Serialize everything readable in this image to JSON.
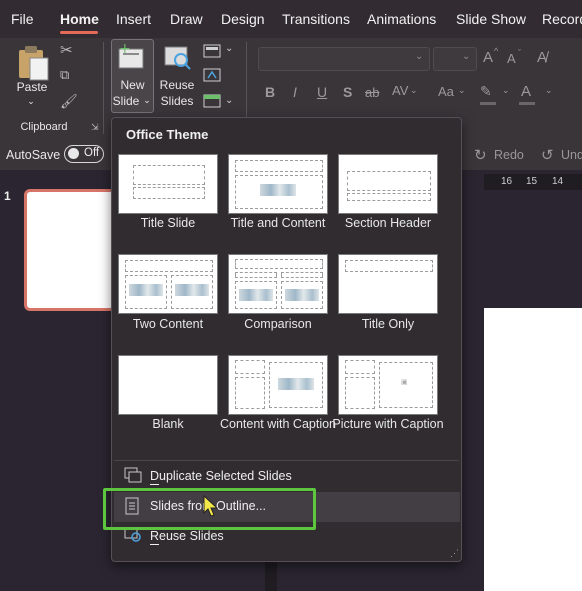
{
  "menubar": {
    "tabs": [
      "File",
      "Home",
      "Insert",
      "Draw",
      "Design",
      "Transitions",
      "Animations",
      "Slide Show",
      "Record"
    ],
    "active": "Home"
  },
  "ribbon": {
    "paste": "Paste",
    "clipboard": "Clipboard",
    "new_slide_1": "New",
    "new_slide_2": "Slide",
    "reuse_slides_1": "Reuse",
    "reuse_slides_2": "Slides",
    "bold": "B",
    "italic": "I",
    "underline": "U",
    "shadow": "S",
    "strike": "ab",
    "spacing": "AV",
    "case": "Aa",
    "font_up": "A",
    "font_down": "A",
    "font_color": "A"
  },
  "row3": {
    "autosave": "AutoSave",
    "toggle_state": "Off",
    "redo": "Redo",
    "undo": "Und"
  },
  "ruler": [
    "16",
    "15",
    "14"
  ],
  "thumbs": {
    "slide_number": "1"
  },
  "dropdown": {
    "title": "Office Theme",
    "layouts": [
      "Title Slide",
      "Title and Content",
      "Section Header",
      "Two Content",
      "Comparison",
      "Title Only",
      "Blank",
      "Content with Caption",
      "Picture with Caption"
    ],
    "commands": {
      "duplicate": "Duplicate Selected Slides",
      "outline": "Slides from Outline...",
      "reuse": "Reuse Slides"
    }
  },
  "colors": {
    "accent": "#e46a5a",
    "highlight_box": "#5ec53e"
  }
}
